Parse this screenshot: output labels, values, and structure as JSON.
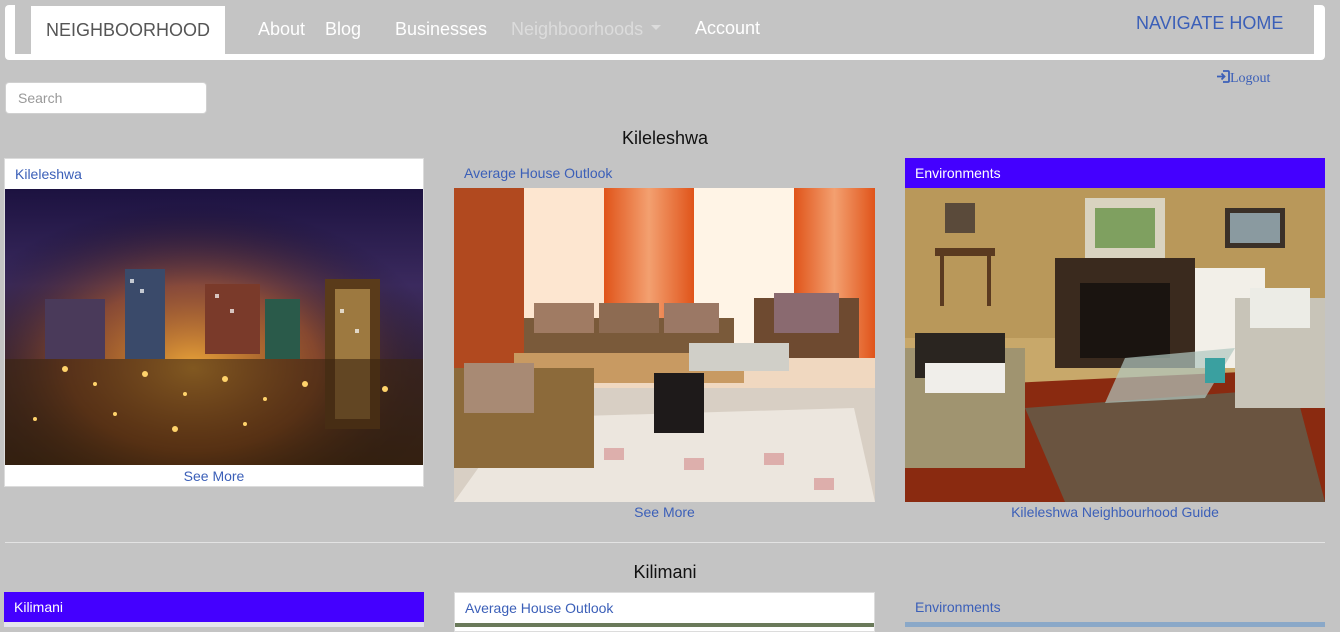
{
  "navbar": {
    "brand": "NEIGHBOORHOOD",
    "links": [
      "About",
      "Blog",
      "Businesses",
      "Neighboorhoods",
      "Account"
    ],
    "home": "NAVIGATE HOME"
  },
  "search": {
    "placeholder": "Search"
  },
  "logout": {
    "label": "Logout",
    "icon": "sign-in-icon"
  },
  "sections": [
    {
      "title": "Kileleshwa",
      "cards": [
        {
          "header": "Kileleshwa",
          "link": "See More",
          "image": "night city skyline"
        },
        {
          "header": "Average House Outlook",
          "link": "See More",
          "image": "living room with couches"
        },
        {
          "header": "Environments",
          "link": "Kileleshwa Neighbourhood Guide",
          "image": "living room with fireplace"
        }
      ]
    },
    {
      "title": "Kilimani",
      "cards": [
        {
          "header": "Kilimani"
        },
        {
          "header": "Average House Outlook"
        },
        {
          "header": "Environments"
        }
      ]
    }
  ],
  "colors": {
    "background": "#c4c4c4",
    "link": "#3b5fb8",
    "highlight_header": "#4400ff"
  }
}
